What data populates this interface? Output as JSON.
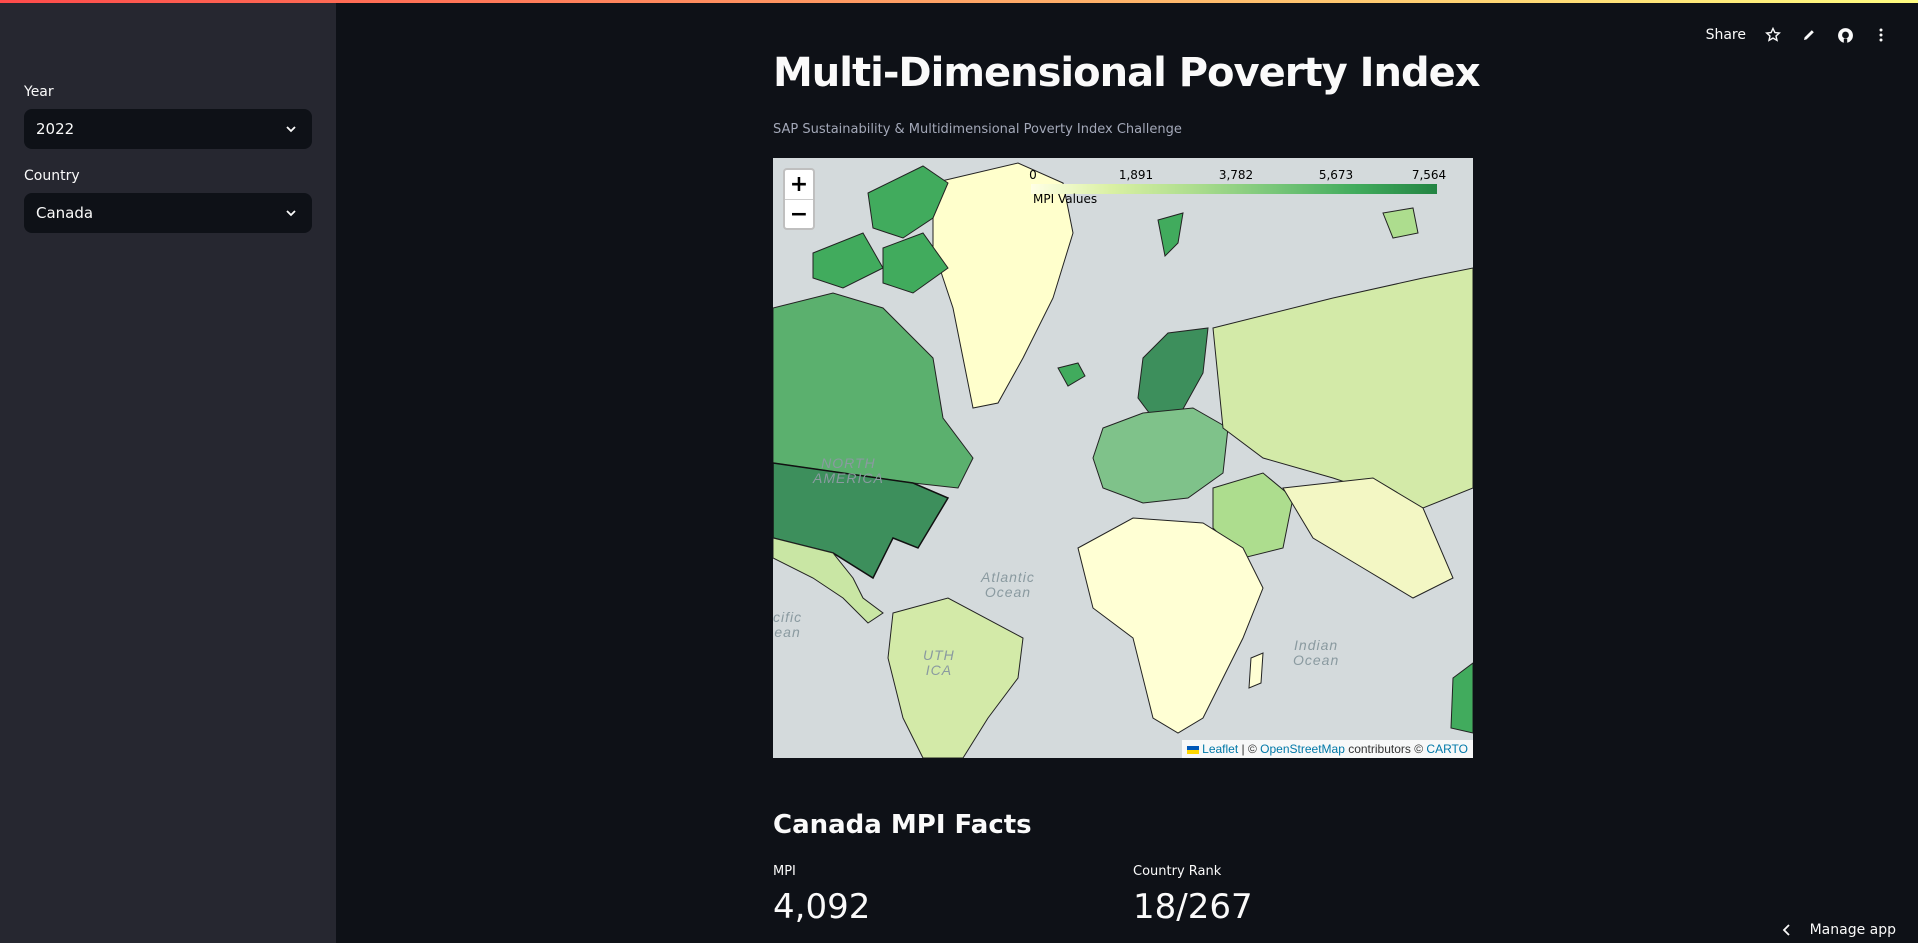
{
  "sidebar": {
    "year": {
      "label": "Year",
      "value": "2022"
    },
    "country": {
      "label": "Country",
      "value": "Canada"
    }
  },
  "header": {
    "share_label": "Share",
    "icons": [
      "star-icon",
      "pencil-icon",
      "github-icon",
      "more-vertical-icon"
    ]
  },
  "main": {
    "title": "Multi-Dimensional Poverty Index",
    "subtitle": "SAP Sustainability & Multidimensional Poverty Index Challenge"
  },
  "map": {
    "zoom_in": "+",
    "zoom_out": "−",
    "legend": {
      "ticks": [
        "0",
        "1,891",
        "3,782",
        "5,673",
        "7,564"
      ],
      "caption": "MPI Values",
      "colors": [
        "#ffffe5",
        "#d9f0a3",
        "#addd8e",
        "#78c679",
        "#41ab5d",
        "#238443"
      ]
    },
    "labels": {
      "north_america": "NORTH\nAMERICA",
      "atlantic": "Atlantic\nOcean",
      "pacific": "cific\nean",
      "south_america": "UTH\nICA",
      "indian": "Indian\nOcean"
    },
    "attribution": {
      "leaflet": "Leaflet",
      "sep": " | © ",
      "osm": "OpenStreetMap",
      "contributors": " contributors © ",
      "carto": "CARTO"
    }
  },
  "facts": {
    "title": "Canada MPI Facts",
    "mpi": {
      "label": "MPI",
      "value": "4,092"
    },
    "rank": {
      "label": "Country Rank",
      "value": "18/267"
    }
  },
  "footer": {
    "manage_label": "Manage app"
  }
}
